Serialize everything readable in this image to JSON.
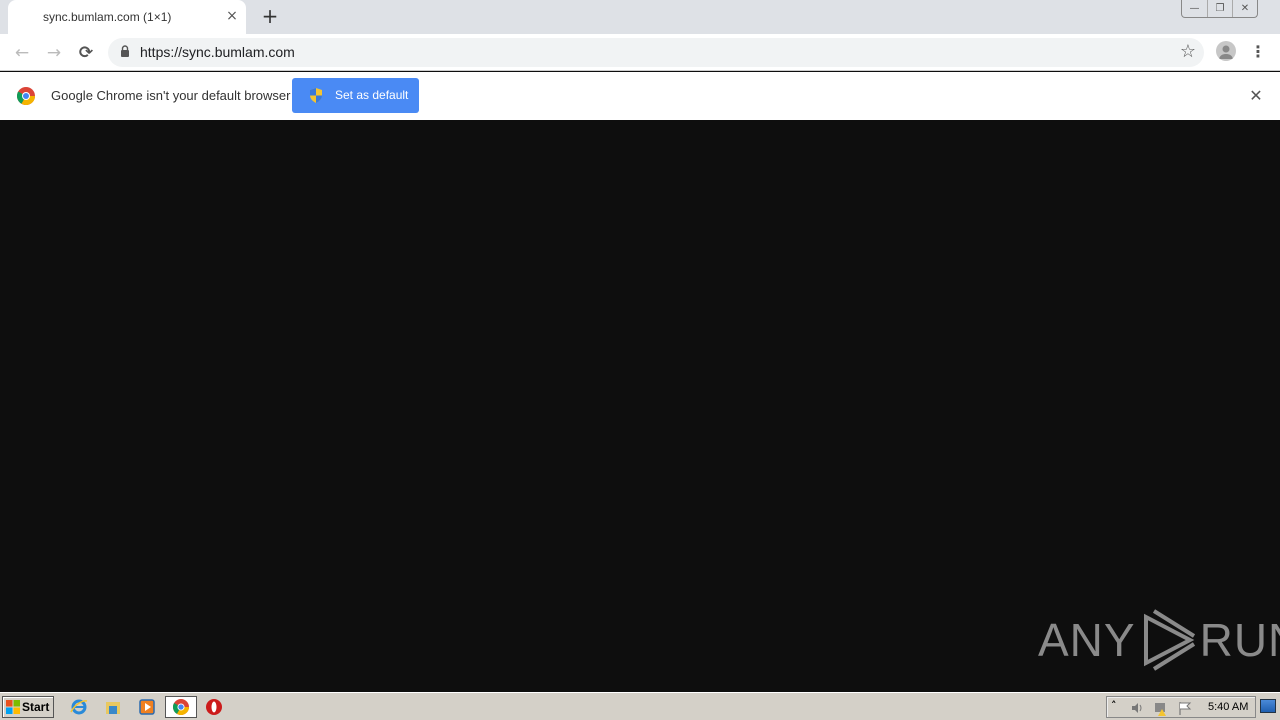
{
  "browser": {
    "tab": {
      "title": "sync.bumlam.com (1×1)",
      "close_icon": "×"
    },
    "new_tab_icon": "+",
    "window_controls": {
      "minimize": "—",
      "restore": "❐",
      "close": "✕"
    },
    "toolbar": {
      "back_icon": "←",
      "forward_icon": "→",
      "reload_icon": "⟳",
      "url": "https://sync.bumlam.com",
      "star_icon": "☆",
      "menu_icon": "⋮"
    },
    "infobar": {
      "message": "Google Chrome isn't your default browser",
      "button_label": "Set as default",
      "close_icon": "✕"
    }
  },
  "page": {
    "background": "#0e0e0e",
    "watermark": {
      "left": "ANY",
      "right": "RUN"
    }
  },
  "taskbar": {
    "start_label": "Start",
    "pinned": [
      "internet-explorer",
      "file-explorer",
      "media-player",
      "chrome",
      "opera"
    ],
    "clock": "5:40 AM"
  },
  "colors": {
    "accent": "#4a8af4",
    "tabstrip": "#dee1e6",
    "taskbar": "#d4d0c8"
  }
}
